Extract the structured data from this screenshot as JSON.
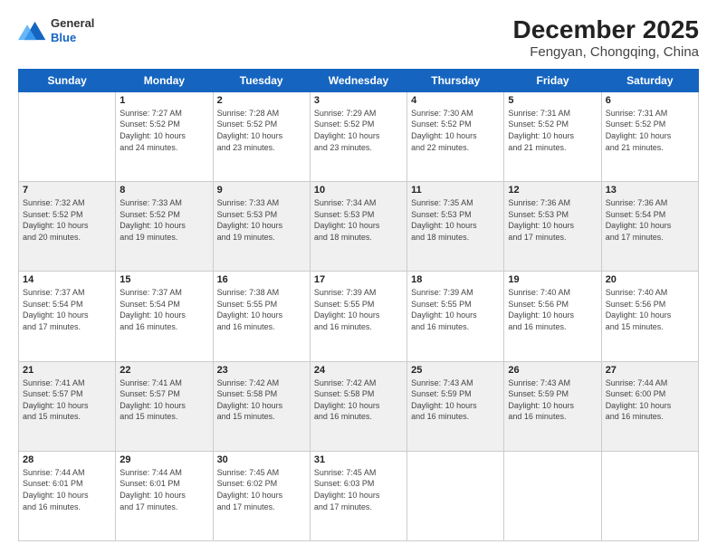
{
  "header": {
    "logo": {
      "line1": "General",
      "line2": "Blue"
    },
    "title": "December 2025",
    "subtitle": "Fengyan, Chongqing, China"
  },
  "weekdays": [
    "Sunday",
    "Monday",
    "Tuesday",
    "Wednesday",
    "Thursday",
    "Friday",
    "Saturday"
  ],
  "weeks": [
    [
      {
        "day": "",
        "info": ""
      },
      {
        "day": "1",
        "info": "Sunrise: 7:27 AM\nSunset: 5:52 PM\nDaylight: 10 hours\nand 24 minutes."
      },
      {
        "day": "2",
        "info": "Sunrise: 7:28 AM\nSunset: 5:52 PM\nDaylight: 10 hours\nand 23 minutes."
      },
      {
        "day": "3",
        "info": "Sunrise: 7:29 AM\nSunset: 5:52 PM\nDaylight: 10 hours\nand 23 minutes."
      },
      {
        "day": "4",
        "info": "Sunrise: 7:30 AM\nSunset: 5:52 PM\nDaylight: 10 hours\nand 22 minutes."
      },
      {
        "day": "5",
        "info": "Sunrise: 7:31 AM\nSunset: 5:52 PM\nDaylight: 10 hours\nand 21 minutes."
      },
      {
        "day": "6",
        "info": "Sunrise: 7:31 AM\nSunset: 5:52 PM\nDaylight: 10 hours\nand 21 minutes."
      }
    ],
    [
      {
        "day": "7",
        "info": "Sunrise: 7:32 AM\nSunset: 5:52 PM\nDaylight: 10 hours\nand 20 minutes."
      },
      {
        "day": "8",
        "info": "Sunrise: 7:33 AM\nSunset: 5:52 PM\nDaylight: 10 hours\nand 19 minutes."
      },
      {
        "day": "9",
        "info": "Sunrise: 7:33 AM\nSunset: 5:53 PM\nDaylight: 10 hours\nand 19 minutes."
      },
      {
        "day": "10",
        "info": "Sunrise: 7:34 AM\nSunset: 5:53 PM\nDaylight: 10 hours\nand 18 minutes."
      },
      {
        "day": "11",
        "info": "Sunrise: 7:35 AM\nSunset: 5:53 PM\nDaylight: 10 hours\nand 18 minutes."
      },
      {
        "day": "12",
        "info": "Sunrise: 7:36 AM\nSunset: 5:53 PM\nDaylight: 10 hours\nand 17 minutes."
      },
      {
        "day": "13",
        "info": "Sunrise: 7:36 AM\nSunset: 5:54 PM\nDaylight: 10 hours\nand 17 minutes."
      }
    ],
    [
      {
        "day": "14",
        "info": "Sunrise: 7:37 AM\nSunset: 5:54 PM\nDaylight: 10 hours\nand 17 minutes."
      },
      {
        "day": "15",
        "info": "Sunrise: 7:37 AM\nSunset: 5:54 PM\nDaylight: 10 hours\nand 16 minutes."
      },
      {
        "day": "16",
        "info": "Sunrise: 7:38 AM\nSunset: 5:55 PM\nDaylight: 10 hours\nand 16 minutes."
      },
      {
        "day": "17",
        "info": "Sunrise: 7:39 AM\nSunset: 5:55 PM\nDaylight: 10 hours\nand 16 minutes."
      },
      {
        "day": "18",
        "info": "Sunrise: 7:39 AM\nSunset: 5:55 PM\nDaylight: 10 hours\nand 16 minutes."
      },
      {
        "day": "19",
        "info": "Sunrise: 7:40 AM\nSunset: 5:56 PM\nDaylight: 10 hours\nand 16 minutes."
      },
      {
        "day": "20",
        "info": "Sunrise: 7:40 AM\nSunset: 5:56 PM\nDaylight: 10 hours\nand 15 minutes."
      }
    ],
    [
      {
        "day": "21",
        "info": "Sunrise: 7:41 AM\nSunset: 5:57 PM\nDaylight: 10 hours\nand 15 minutes."
      },
      {
        "day": "22",
        "info": "Sunrise: 7:41 AM\nSunset: 5:57 PM\nDaylight: 10 hours\nand 15 minutes."
      },
      {
        "day": "23",
        "info": "Sunrise: 7:42 AM\nSunset: 5:58 PM\nDaylight: 10 hours\nand 15 minutes."
      },
      {
        "day": "24",
        "info": "Sunrise: 7:42 AM\nSunset: 5:58 PM\nDaylight: 10 hours\nand 16 minutes."
      },
      {
        "day": "25",
        "info": "Sunrise: 7:43 AM\nSunset: 5:59 PM\nDaylight: 10 hours\nand 16 minutes."
      },
      {
        "day": "26",
        "info": "Sunrise: 7:43 AM\nSunset: 5:59 PM\nDaylight: 10 hours\nand 16 minutes."
      },
      {
        "day": "27",
        "info": "Sunrise: 7:44 AM\nSunset: 6:00 PM\nDaylight: 10 hours\nand 16 minutes."
      }
    ],
    [
      {
        "day": "28",
        "info": "Sunrise: 7:44 AM\nSunset: 6:01 PM\nDaylight: 10 hours\nand 16 minutes."
      },
      {
        "day": "29",
        "info": "Sunrise: 7:44 AM\nSunset: 6:01 PM\nDaylight: 10 hours\nand 17 minutes."
      },
      {
        "day": "30",
        "info": "Sunrise: 7:45 AM\nSunset: 6:02 PM\nDaylight: 10 hours\nand 17 minutes."
      },
      {
        "day": "31",
        "info": "Sunrise: 7:45 AM\nSunset: 6:03 PM\nDaylight: 10 hours\nand 17 minutes."
      },
      {
        "day": "",
        "info": ""
      },
      {
        "day": "",
        "info": ""
      },
      {
        "day": "",
        "info": ""
      }
    ]
  ]
}
